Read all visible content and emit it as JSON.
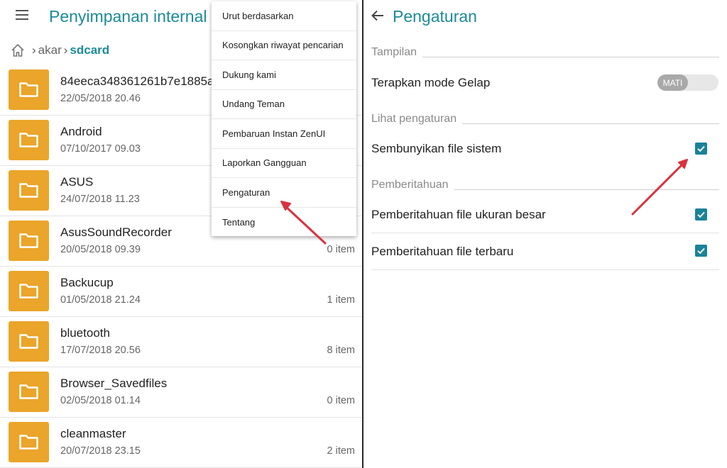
{
  "left": {
    "title": "Penyimpanan internal",
    "breadcrumb": {
      "root": "akar",
      "current": "sdcard"
    },
    "files": [
      {
        "name": "84eeca348361261b7e1885a",
        "date": "22/05/2018 20.46",
        "count": ""
      },
      {
        "name": "Android",
        "date": "07/10/2017 09.03",
        "count": ""
      },
      {
        "name": "ASUS",
        "date": "24/07/2018 11.23",
        "count": ""
      },
      {
        "name": "AsusSoundRecorder",
        "date": "20/05/2018 09.39",
        "count": "0 item"
      },
      {
        "name": "Backucup",
        "date": "01/05/2018 21.24",
        "count": "1 item"
      },
      {
        "name": "bluetooth",
        "date": "17/07/2018 20.56",
        "count": "8 item"
      },
      {
        "name": "Browser_Savedfiles",
        "date": "02/05/2018 01.14",
        "count": "0 item"
      },
      {
        "name": "cleanmaster",
        "date": "20/07/2018 23.15",
        "count": "2 item"
      }
    ],
    "menu": [
      "Urut berdasarkan",
      "Kosongkan riwayat pencarian",
      "Dukung kami",
      "Undang Teman",
      "Pembaruan Instan ZenUI",
      "Laporkan Gangguan",
      "Pengaturan",
      "Tentang"
    ]
  },
  "right": {
    "title": "Pengaturan",
    "sections": {
      "display": "Tampilan",
      "view": "Lihat pengaturan",
      "notify": "Pemberitahuan"
    },
    "settings": {
      "dark_mode": "Terapkan mode Gelap",
      "dark_mode_state": "MATI",
      "hide_system": "Sembunyikan file sistem",
      "notify_large": "Pemberitahuan file ukuran besar",
      "notify_new": "Pemberitahuan file terbaru"
    }
  },
  "colors": {
    "accent": "#1c8a9a",
    "folder": "#eaa52a",
    "checkbox": "#1a8299",
    "arrow": "#d9323f"
  }
}
